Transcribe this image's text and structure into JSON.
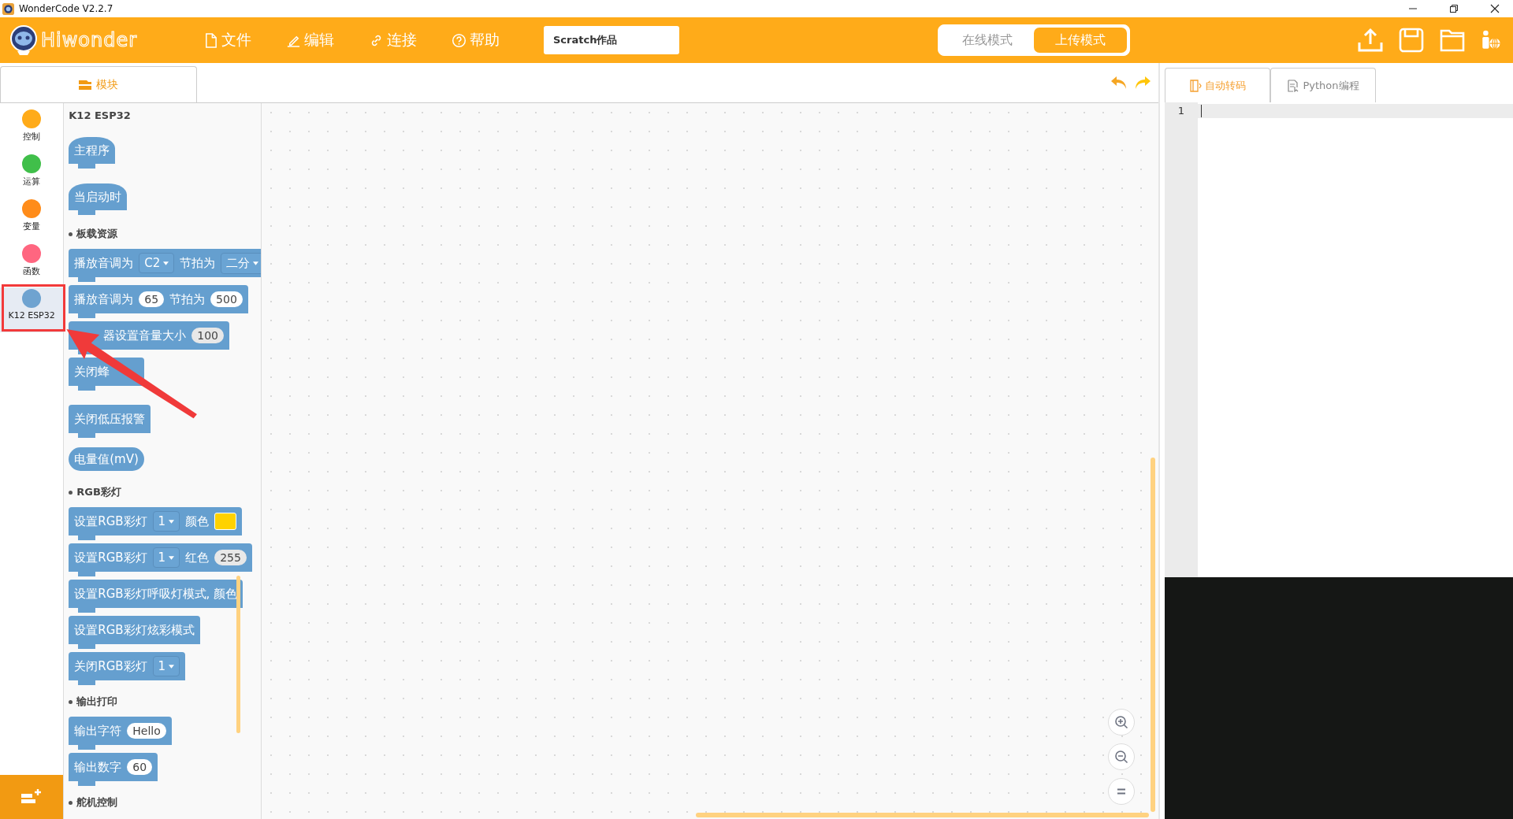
{
  "window": {
    "title": "WonderCode V2.2.7"
  },
  "logo": {
    "text": "Hiwonder"
  },
  "menu": [
    {
      "label": "文件",
      "kind": "file"
    },
    {
      "label": "编辑",
      "kind": "edit"
    },
    {
      "label": "连接",
      "kind": "link"
    },
    {
      "label": "帮助",
      "kind": "help"
    }
  ],
  "project_name": {
    "value": "Scratch作品"
  },
  "modes": [
    {
      "label": "在线模式",
      "selected": false
    },
    {
      "label": "上传模式",
      "selected": true
    }
  ],
  "block_tab": {
    "label": "模块"
  },
  "categories": [
    {
      "label": "控制",
      "color": "#ffab19",
      "selected": false
    },
    {
      "label": "运算",
      "color": "#40bf4a",
      "selected": false
    },
    {
      "label": "变量",
      "color": "#ff8c1a",
      "selected": false
    },
    {
      "label": "函数",
      "color": "#ff6680",
      "selected": false
    },
    {
      "label": "K12 ESP32",
      "color": "#6fa3d0",
      "selected": true
    }
  ],
  "palette": {
    "title": "K12 ESP32",
    "items": [
      {
        "kind": "hat",
        "parts": [
          {
            "kind": "text",
            "text": "主程序"
          }
        ]
      },
      {
        "kind": "hat",
        "parts": [
          {
            "kind": "text",
            "text": "当启动时"
          }
        ]
      },
      {
        "kind": "section",
        "text": "板载资源"
      },
      {
        "kind": "stack",
        "parts": [
          {
            "kind": "text",
            "text": "播放音调为"
          },
          {
            "kind": "dropdown",
            "text": "C2"
          },
          {
            "kind": "text",
            "text": "节拍为"
          },
          {
            "kind": "dropdown",
            "text": "二分"
          }
        ]
      },
      {
        "kind": "stack",
        "parts": [
          {
            "kind": "text",
            "text": "播放音调为"
          },
          {
            "kind": "number",
            "text": "65"
          },
          {
            "kind": "text",
            "text": "节拍为"
          },
          {
            "kind": "number",
            "text": "500"
          }
        ]
      },
      {
        "kind": "stack",
        "parts": [
          {
            "kind": "gap"
          },
          {
            "kind": "text",
            "text": "器设置音量大小"
          },
          {
            "kind": "number_dim",
            "text": "100"
          }
        ]
      },
      {
        "kind": "stack",
        "parts": [
          {
            "kind": "text",
            "text": "关闭蜂"
          },
          {
            "kind": "gap"
          }
        ]
      },
      {
        "kind": "stack",
        "parts": [
          {
            "kind": "text",
            "text": "关闭低压报警"
          }
        ]
      },
      {
        "kind": "reporter",
        "parts": [
          {
            "kind": "text",
            "text": "电量值(mV)"
          }
        ]
      },
      {
        "kind": "section",
        "text": "RGB彩灯"
      },
      {
        "kind": "stack",
        "parts": [
          {
            "kind": "text",
            "text": "设置RGB彩灯"
          },
          {
            "kind": "dropdown",
            "text": "1"
          },
          {
            "kind": "text",
            "text": "颜色"
          },
          {
            "kind": "color",
            "color": "#ffd200"
          }
        ]
      },
      {
        "kind": "stack",
        "parts": [
          {
            "kind": "text",
            "text": "设置RGB彩灯"
          },
          {
            "kind": "dropdown",
            "text": "1"
          },
          {
            "kind": "text",
            "text": "红色"
          },
          {
            "kind": "number_dim",
            "text": "255"
          }
        ]
      },
      {
        "kind": "stack",
        "parts": [
          {
            "kind": "text",
            "text": "设置RGB彩灯呼吸灯模式, 颜色"
          }
        ]
      },
      {
        "kind": "stack",
        "parts": [
          {
            "kind": "text",
            "text": "设置RGB彩灯炫彩模式"
          }
        ]
      },
      {
        "kind": "stack",
        "parts": [
          {
            "kind": "text",
            "text": "关闭RGB彩灯"
          },
          {
            "kind": "dropdown",
            "text": "1"
          }
        ]
      },
      {
        "kind": "section",
        "text": "输出打印"
      },
      {
        "kind": "stack",
        "parts": [
          {
            "kind": "text",
            "text": "输出字符"
          },
          {
            "kind": "number",
            "text": "Hello"
          }
        ]
      },
      {
        "kind": "stack",
        "parts": [
          {
            "kind": "text",
            "text": "输出数字"
          },
          {
            "kind": "number",
            "text": "60"
          }
        ]
      },
      {
        "kind": "section",
        "text": "舵机控制"
      }
    ]
  },
  "code_tabs": [
    {
      "label": "自动转码",
      "selected": true
    },
    {
      "label": "Python编程",
      "selected": false
    }
  ],
  "editor": {
    "line_numbers": [
      "1"
    ]
  }
}
